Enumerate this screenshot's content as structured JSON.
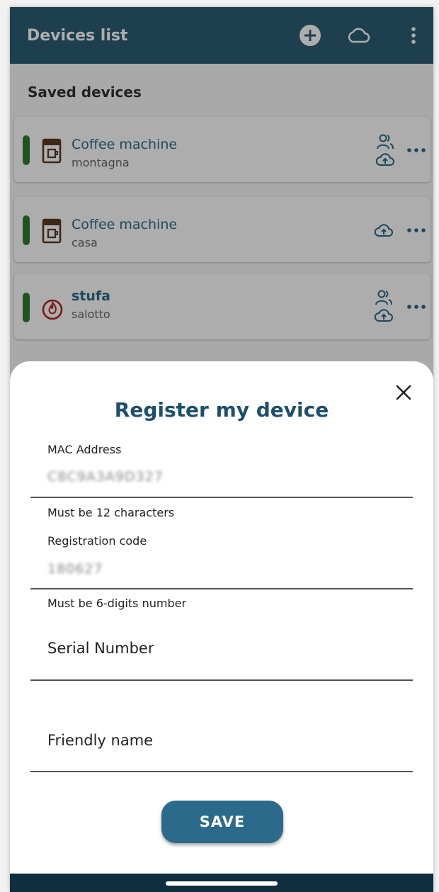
{
  "app_bar": {
    "title": "Devices list",
    "icons": [
      "add-circle-icon",
      "cloud-icon",
      "more-vert-icon"
    ]
  },
  "list": {
    "section_title": "Saved devices",
    "devices": [
      {
        "name": "Coffee machine",
        "location": "montagna",
        "icon": "coffee-machine-icon",
        "status_color": "#2e7d32",
        "shared": true,
        "cloud": true
      },
      {
        "name": "Coffee machine",
        "location": "casa",
        "icon": "coffee-machine-icon",
        "status_color": "#2e7d32",
        "shared": false,
        "cloud": true
      },
      {
        "name": "stufa",
        "location": "salotto",
        "icon": "flame-icon",
        "status_color": "#2e7d32",
        "shared": true,
        "cloud": true
      }
    ]
  },
  "sheet": {
    "title": "Register my device",
    "fields": {
      "mac": {
        "label": "MAC Address",
        "value": "C8C9A3A9D327",
        "helper": "Must be 12 characters"
      },
      "registration": {
        "label": "Registration code",
        "value": "180627",
        "helper": "Must be 6-digits number"
      },
      "serial": {
        "placeholder": "Serial Number"
      },
      "friendly": {
        "placeholder": "Friendly name"
      }
    },
    "save_label": "SAVE"
  },
  "colors": {
    "app_bar": "#2c5d74",
    "accent": "#2c6a8c",
    "title": "#1d4f6c",
    "status_online": "#2e7d32",
    "coffee_icon": "#5b3a1f",
    "flame_icon": "#b3261e"
  }
}
